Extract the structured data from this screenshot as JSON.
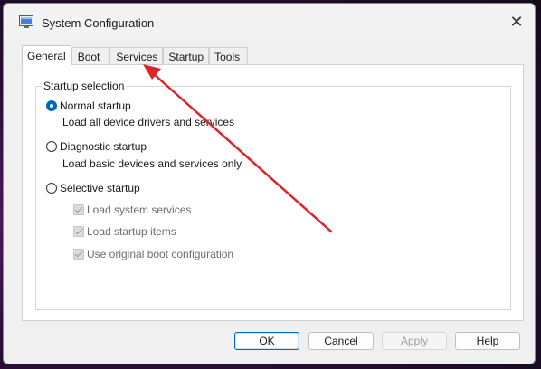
{
  "window": {
    "title": "System Configuration",
    "close_glyph": "✕",
    "app_icon": "msconfig-icon"
  },
  "tabs": [
    {
      "label": "General",
      "active": true
    },
    {
      "label": "Boot",
      "active": false
    },
    {
      "label": "Services",
      "active": false
    },
    {
      "label": "Startup",
      "active": false
    },
    {
      "label": "Tools",
      "active": false
    }
  ],
  "general": {
    "group_label": "Startup selection",
    "options": [
      {
        "label": "Normal startup",
        "description": "Load all device drivers and services",
        "selected": true
      },
      {
        "label": "Diagnostic startup",
        "description": "Load basic devices and services only",
        "selected": false
      },
      {
        "label": "Selective startup",
        "selected": false
      }
    ],
    "selective_items": [
      {
        "label": "Load system services",
        "checked": true,
        "enabled": false
      },
      {
        "label": "Load startup items",
        "checked": true,
        "enabled": false
      },
      {
        "label": "Use original boot configuration",
        "checked": true,
        "enabled": false
      }
    ]
  },
  "buttons": {
    "ok": "OK",
    "cancel": "Cancel",
    "apply": "Apply",
    "help": "Help"
  },
  "annotation": {
    "arrow_color": "#d9262b",
    "points_to": "tab-services"
  },
  "colors": {
    "accent": "#0067c0",
    "window_bg": "#f0f0f0",
    "panel_bg": "#ffffff"
  }
}
